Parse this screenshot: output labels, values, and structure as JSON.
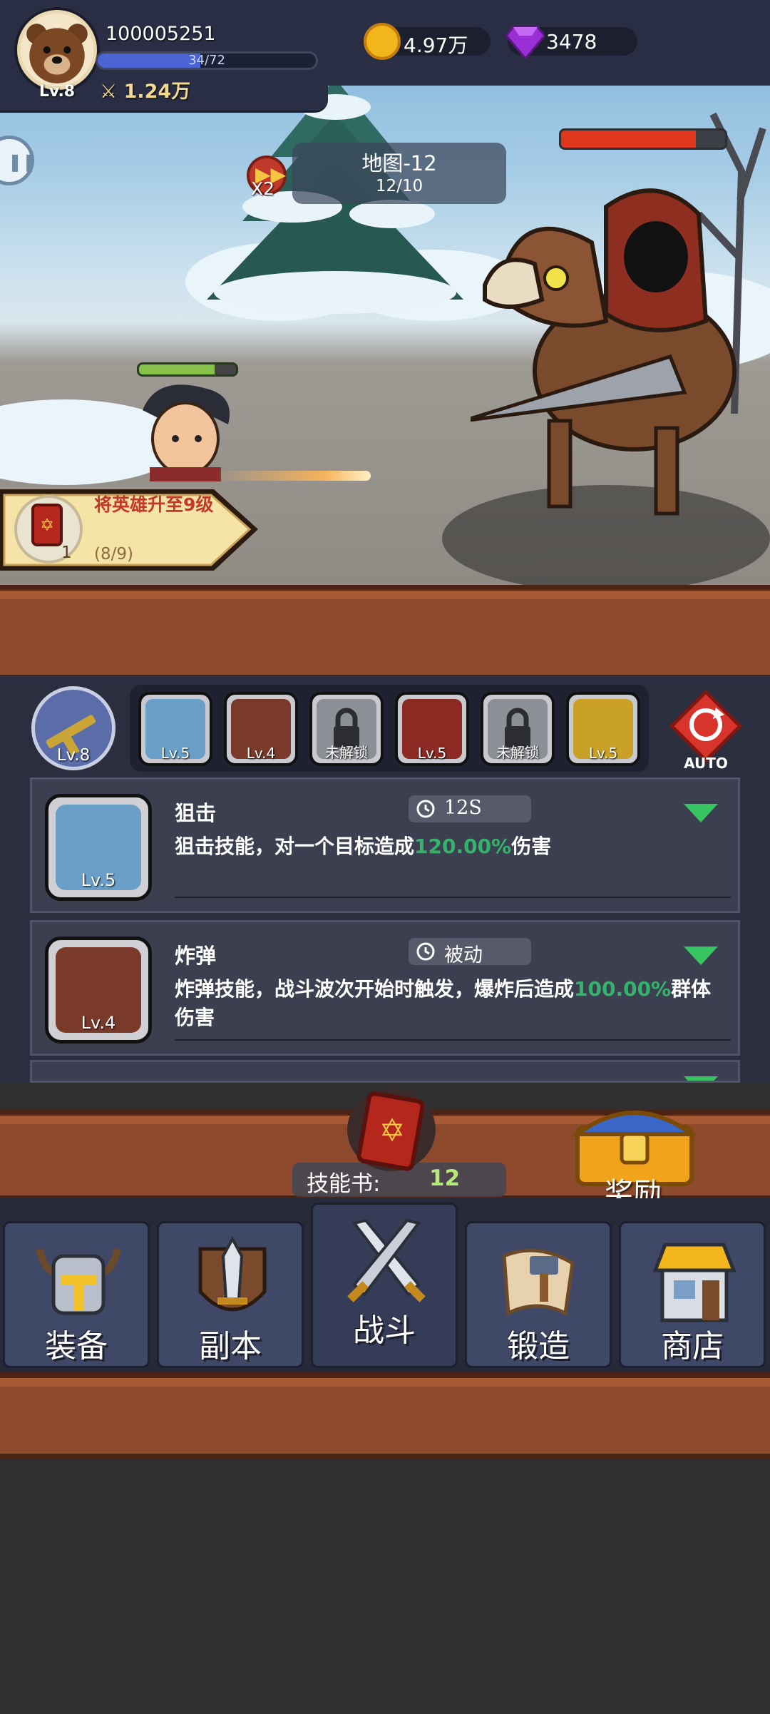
{
  "player": {
    "id": "100005251",
    "level_label": "Lv.8",
    "xp_text": "34/72",
    "xp_fraction": 0.47,
    "power": "1.24万"
  },
  "currency": {
    "gold": "4.97万",
    "gems": "3478"
  },
  "battle": {
    "map_title": "地图-12",
    "map_progress": "12/10",
    "speed_label": "X2",
    "boss_hp_fraction": 0.82,
    "hero_hp_fraction": 0.78
  },
  "quest": {
    "text": "将英雄升至9级",
    "progress": "(8/9)",
    "reward_count": "1"
  },
  "weapon": {
    "level_label": "Lv.8"
  },
  "skill_slots": [
    {
      "label": "Lv.5",
      "color": "#6aa0c8"
    },
    {
      "label": "Lv.4",
      "color": "#7a3a2a"
    },
    {
      "label": "未解锁",
      "color": "#8d8f96"
    },
    {
      "label": "Lv.5",
      "color": "#8a2a22"
    },
    {
      "label": "未解锁",
      "color": "#8d8f96"
    },
    {
      "label": "Lv.5",
      "color": "#c9a126"
    }
  ],
  "auto_label": "AUTO",
  "skills": [
    {
      "name": "狙击",
      "cooldown": "12S",
      "level_label": "Lv.5",
      "desc_before": "狙击技能，对一个目标造成",
      "desc_value": "120.00%",
      "desc_after": "伤害"
    },
    {
      "name": "炸弹",
      "cooldown": "被动",
      "level_label": "Lv.4",
      "desc_before": "炸弹技能，战斗波次开始时触发，爆炸后造成",
      "desc_value": "100.00%",
      "desc_after": "群体伤害"
    }
  ],
  "skillbook": {
    "label": "技能书:",
    "value": "12"
  },
  "reward_label": "奖励",
  "nav": [
    {
      "label": "装备",
      "icon": "helmet-icon"
    },
    {
      "label": "副本",
      "icon": "sword-shield-icon"
    },
    {
      "label": "战斗",
      "icon": "crossed-swords-icon"
    },
    {
      "label": "锻造",
      "icon": "scroll-hammer-icon"
    },
    {
      "label": "商店",
      "icon": "shop-icon"
    }
  ],
  "colors": {
    "accent_green": "#34b46a",
    "wood": "#8e4a2d",
    "panel": "#2b2e3e"
  }
}
